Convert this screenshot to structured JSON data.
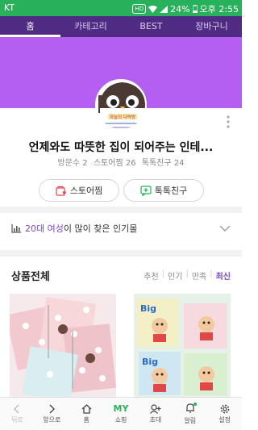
{
  "status_bar": {
    "carrier": "KT",
    "hd": "HD",
    "battery": "24%",
    "time": "오후 2:55"
  },
  "tabs": [
    {
      "label": "홈",
      "active": true
    },
    {
      "label": "카테고리",
      "active": false
    },
    {
      "label": "BEST",
      "active": false
    },
    {
      "label": "장바구니",
      "active": false
    }
  ],
  "profile": {
    "store_name": "언제와도 따뜻한 집이 되어주는 인테...",
    "avatar_sign": "하늘의 다락방",
    "stats": {
      "visitors": "방문수 2",
      "store_jjim": "스토어찜 26",
      "talk_friends": "톡톡친구 24"
    },
    "store_jjim_label": "스토어찜",
    "talk_friend_label": "톡톡친구"
  },
  "popular": {
    "prefix": "20대 여성",
    "suffix": "이 많이 찾은 인기몰"
  },
  "products": {
    "title": "상품전체",
    "sort": [
      {
        "label": "추천",
        "active": false
      },
      {
        "label": "인기",
        "active": false
      },
      {
        "label": "만족",
        "active": false
      },
      {
        "label": "최신",
        "active": true
      }
    ]
  },
  "bottom_nav": [
    {
      "label": "뒤로",
      "icon": "back-arrow-icon",
      "disabled": true
    },
    {
      "label": "앞으로",
      "icon": "forward-arrow-icon",
      "disabled": false
    },
    {
      "label": "홈",
      "icon": "home-icon",
      "disabled": false
    },
    {
      "label": "쇼핑",
      "icon": "my-shopping",
      "top_text": "MY",
      "disabled": false
    },
    {
      "label": "초대",
      "icon": "invite-icon",
      "disabled": false
    },
    {
      "label": "알림",
      "icon": "bell-icon",
      "disabled": false
    },
    {
      "label": "설정",
      "icon": "gear-icon",
      "disabled": false
    }
  ],
  "colors": {
    "status": "#27b15b",
    "tab_bar": "#4f2b83",
    "banner": "#b45ff2",
    "accent": "#7a46c7"
  }
}
